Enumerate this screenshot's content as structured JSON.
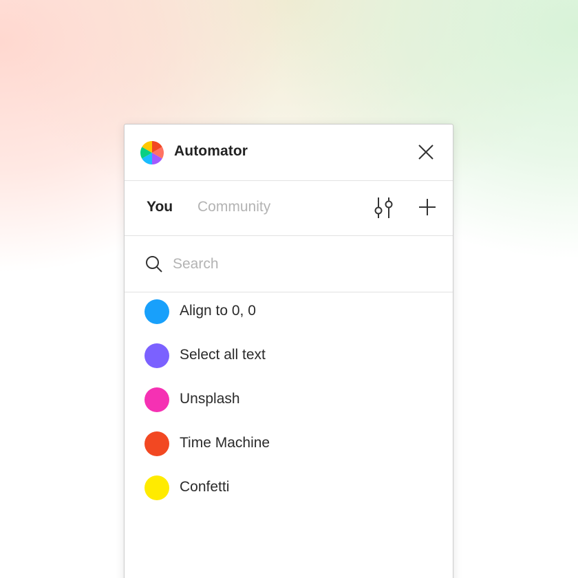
{
  "app": {
    "title": "Automator",
    "logo_icon": "automator-logo-icon",
    "close_icon": "close-icon"
  },
  "tabs": [
    {
      "label": "You",
      "active": true
    },
    {
      "label": "Community",
      "active": false
    }
  ],
  "toolbar": {
    "filter_icon": "sliders-icon",
    "add_icon": "plus-icon"
  },
  "search": {
    "placeholder": "Search",
    "value": "",
    "icon": "search-icon"
  },
  "automations": [
    {
      "label": "Align to 0, 0",
      "color": "#18A0FB"
    },
    {
      "label": "Select all text",
      "color": "#7B61FF"
    },
    {
      "label": "Unsplash",
      "color": "#F531B3"
    },
    {
      "label": "Time Machine",
      "color": "#F24822"
    },
    {
      "label": "Confetti",
      "color": "#FFEB00"
    }
  ]
}
